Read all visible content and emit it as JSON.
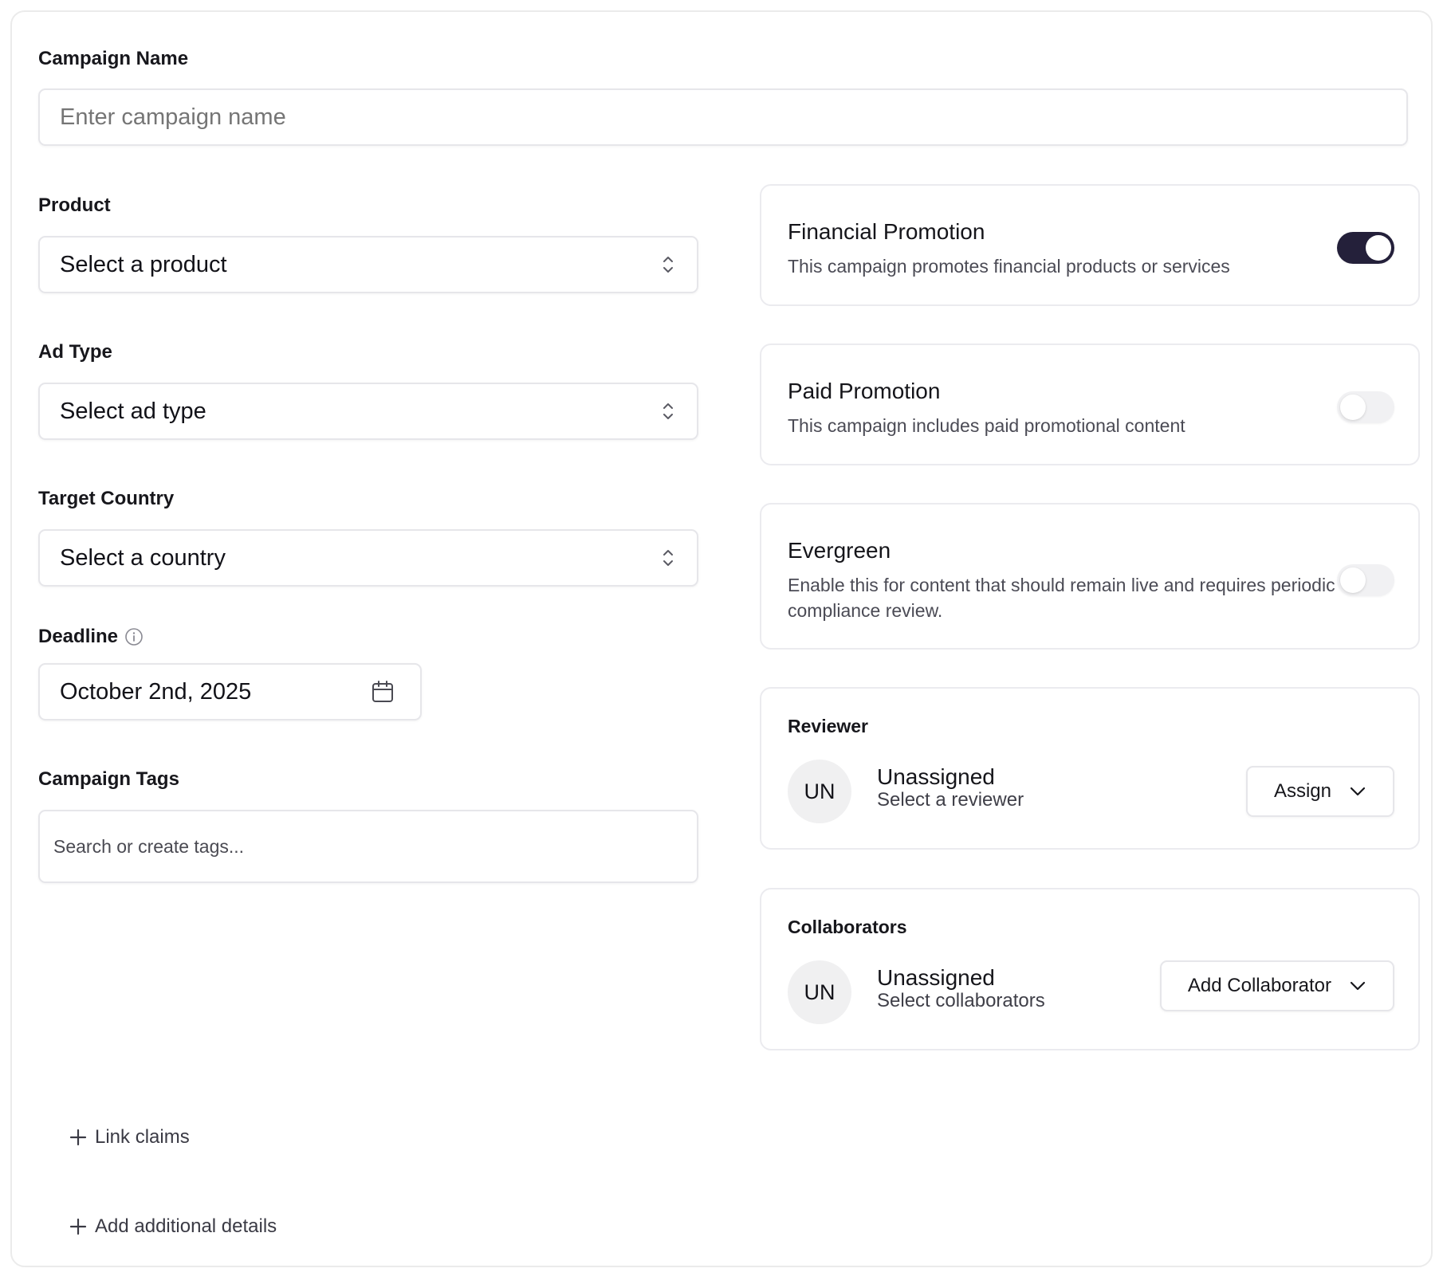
{
  "campaign_name": {
    "label": "Campaign Name",
    "placeholder": "Enter campaign name",
    "value": ""
  },
  "product": {
    "label": "Product",
    "value": "Select a product"
  },
  "ad_type": {
    "label": "Ad Type",
    "value": "Select ad type"
  },
  "target_country": {
    "label": "Target Country",
    "value": "Select a country"
  },
  "deadline": {
    "label": "Deadline",
    "value": "October 2nd, 2025"
  },
  "campaign_tags": {
    "label": "Campaign Tags",
    "placeholder": "Search or create tags..."
  },
  "toggles": {
    "financial": {
      "title": "Financial Promotion",
      "description": "This campaign promotes financial products or services",
      "enabled": true
    },
    "paid": {
      "title": "Paid Promotion",
      "description": "This campaign includes paid promotional content",
      "enabled": false
    },
    "evergreen": {
      "title": "Evergreen",
      "description": "Enable this for content that should remain live and requires periodic compliance review.",
      "enabled": false
    }
  },
  "reviewer": {
    "label": "Reviewer",
    "initials": "UN",
    "name": "Unassigned",
    "subtitle": "Select a reviewer",
    "button": "Assign"
  },
  "collaborators": {
    "label": "Collaborators",
    "initials": "UN",
    "name": "Unassigned",
    "subtitle": "Select collaborators",
    "button": "Add Collaborator"
  },
  "actions": {
    "link_claims": "Link claims",
    "add_details": "Add additional details"
  },
  "colors": {
    "toggle_on": "#24203a",
    "toggle_off": "#f1f1f3",
    "border": "#e6e6ea",
    "avatar_bg": "#f0f0f1"
  },
  "icons": {
    "select_chevron": "chevron-up-down-icon",
    "deadline_info": "info-icon",
    "deadline_picker": "calendar-icon",
    "dropdown": "chevron-down-icon",
    "add": "plus-icon"
  }
}
